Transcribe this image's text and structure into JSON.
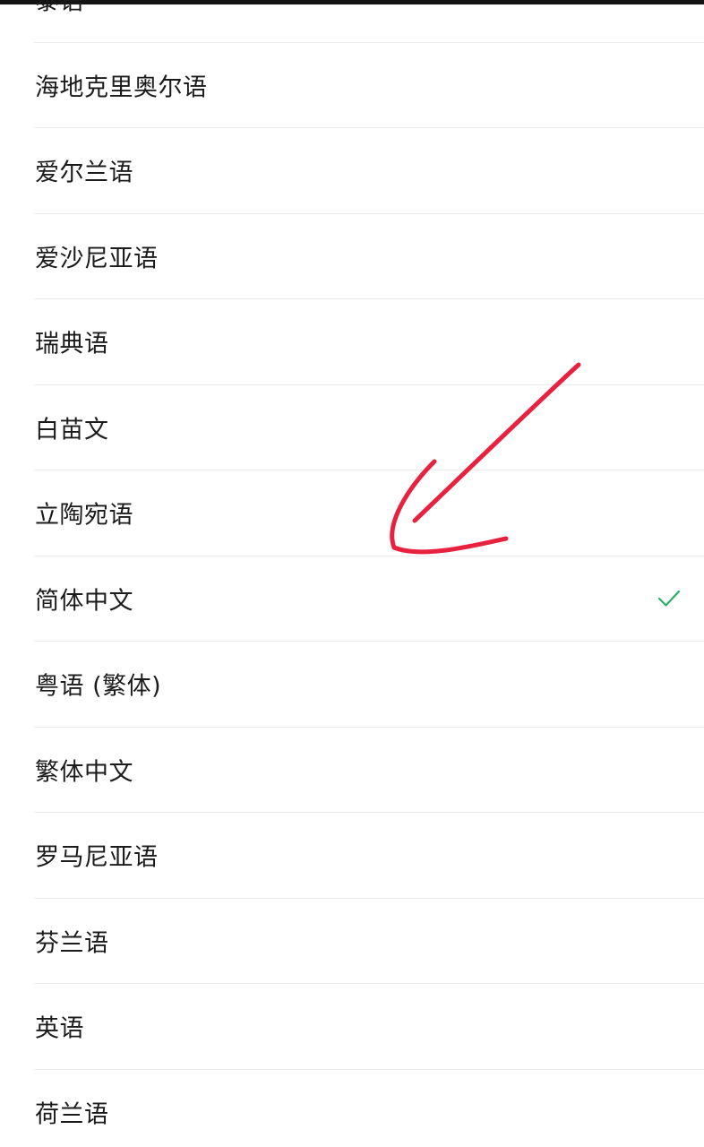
{
  "language_list": {
    "items": [
      {
        "label": "泰语",
        "selected": false
      },
      {
        "label": "海地克里奥尔语",
        "selected": false
      },
      {
        "label": "爱尔兰语",
        "selected": false
      },
      {
        "label": "爱沙尼亚语",
        "selected": false
      },
      {
        "label": "瑞典语",
        "selected": false
      },
      {
        "label": "白苗文",
        "selected": false
      },
      {
        "label": "立陶宛语",
        "selected": false
      },
      {
        "label": "简体中文",
        "selected": true
      },
      {
        "label": "粤语 (繁体)",
        "selected": false
      },
      {
        "label": "繁体中文",
        "selected": false
      },
      {
        "label": "罗马尼亚语",
        "selected": false
      },
      {
        "label": "芬兰语",
        "selected": false
      },
      {
        "label": "英语",
        "selected": false
      },
      {
        "label": "荷兰语",
        "selected": false
      }
    ],
    "check_icon": "checkmark-icon",
    "check_color": "#2aae67"
  },
  "annotation": {
    "icon": "arrow-icon",
    "color": "#e8213f"
  },
  "colors": {
    "text": "#1b1b1b",
    "divider": "#ececec",
    "top_bar": "#141414",
    "background": "#ffffff"
  }
}
